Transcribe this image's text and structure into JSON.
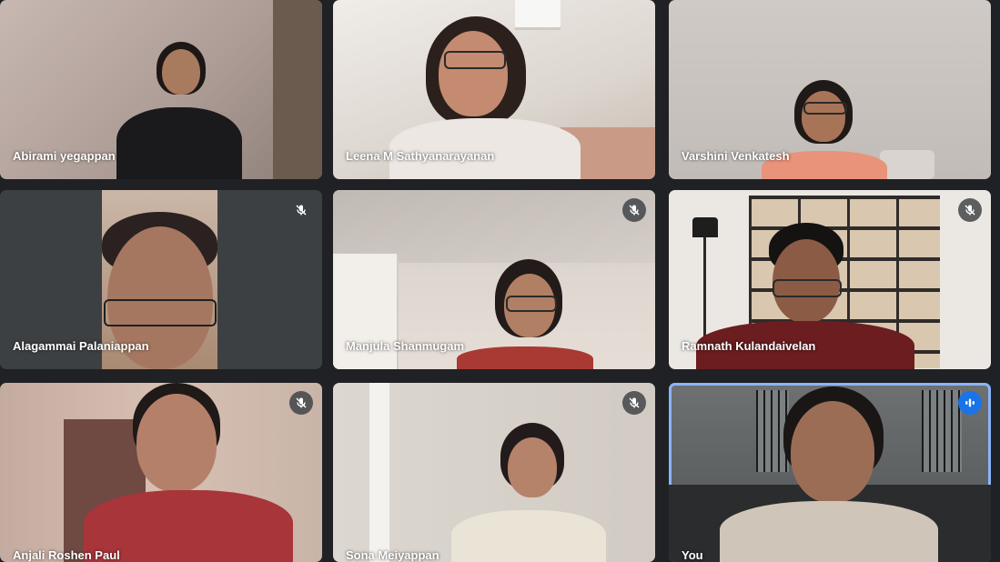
{
  "participants": [
    {
      "name": "Abirami yegappan",
      "muted": false,
      "bg": "#b9a9a3"
    },
    {
      "name": "Leena M Sathyanarayanan",
      "muted": false,
      "bg": "#e9e4de"
    },
    {
      "name": "Varshini Venkatesh",
      "muted": false,
      "bg": "#c9c3bf"
    },
    {
      "name": "Alagammai Palaniappan",
      "muted": true,
      "bg": "#3c4043"
    },
    {
      "name": "Manjula Shanmugam",
      "muted": true,
      "bg": "#d9d2cb"
    },
    {
      "name": "Ramnath Kulandaivelan",
      "muted": true,
      "bg": "#e7e4e0"
    },
    {
      "name": "Anjali Roshen Paul",
      "muted": true,
      "bg": "#c8aea6"
    },
    {
      "name": "Sona Meiyappan",
      "muted": true,
      "bg": "#d6d0c8"
    },
    {
      "name": "You",
      "muted": false,
      "speaking": true,
      "bg": "#5b5f61"
    }
  ],
  "icons": {
    "muted": "mic-off-icon",
    "speaking": "audio-levels-icon"
  },
  "colors": {
    "background": "#202124",
    "tile": "#3c4043",
    "self_border": "#8ab4f8",
    "speaking": "#1a73e8"
  }
}
